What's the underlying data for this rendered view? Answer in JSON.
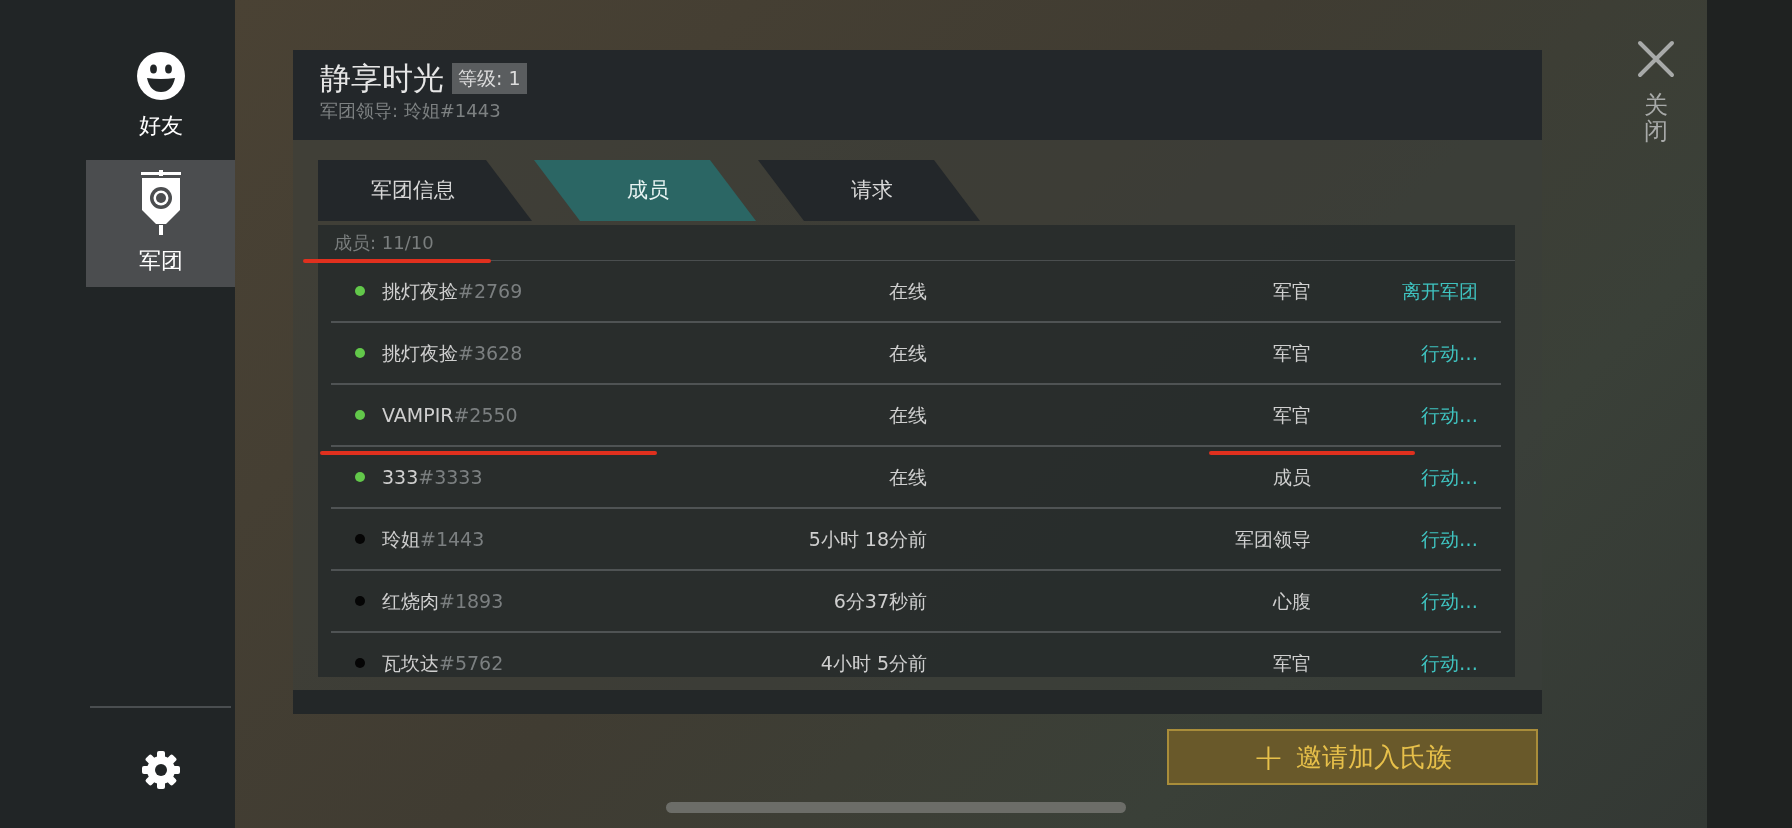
{
  "sidebar": {
    "items": [
      {
        "label": "好友",
        "kind": "friends",
        "selected": false
      },
      {
        "label": "军团",
        "kind": "legion",
        "selected": true
      }
    ]
  },
  "header": {
    "title": "静享时光",
    "level_badge": "等级: 1",
    "leader": "军团领导: 玲姐#1443"
  },
  "tabs": [
    {
      "label": "军团信息",
      "selected": false
    },
    {
      "label": "成员",
      "selected": true
    },
    {
      "label": "请求",
      "selected": false
    }
  ],
  "members_count": "成员: 11/10",
  "members": [
    {
      "name": "挑灯夜捡",
      "tag": "#2769",
      "online": true,
      "status": "在线",
      "role": "军官",
      "action": "离开军团"
    },
    {
      "name": "挑灯夜捡",
      "tag": "#3628",
      "online": true,
      "status": "在线",
      "role": "军官",
      "action": "行动…"
    },
    {
      "name": "VAMPIR",
      "tag": "#2550",
      "online": true,
      "status": "在线",
      "role": "军官",
      "action": "行动…"
    },
    {
      "name": "333",
      "tag": "#3333",
      "online": true,
      "status": "在线",
      "role": "成员",
      "action": "行动…"
    },
    {
      "name": "玲姐",
      "tag": "#1443",
      "online": false,
      "status": "5小时 18分前",
      "role": "军团领导",
      "action": "行动…"
    },
    {
      "name": "红烧肉",
      "tag": "#1893",
      "online": false,
      "status": "6分37秒前",
      "role": "心腹",
      "action": "行动…"
    },
    {
      "name": "瓦坎达",
      "tag": "#5762",
      "online": false,
      "status": "4小时 5分前",
      "role": "军官",
      "action": "行动…"
    }
  ],
  "close": {
    "label": "关闭"
  },
  "invite_button": {
    "icon": "+",
    "label": "邀请加入氏族"
  }
}
